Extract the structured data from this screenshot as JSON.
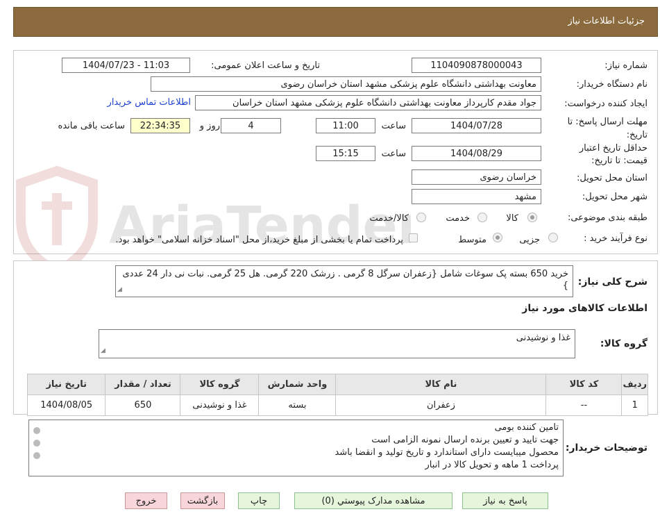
{
  "header": {
    "title": "جزئیات اطلاعات نیاز"
  },
  "form": {
    "need_number_label": "شماره نیاز:",
    "need_number": "1104090878000043",
    "announce_label": "تاریخ و ساعت اعلان عمومی:",
    "announce_value": "1404/07/23 - 11:03",
    "buyer_label": "نام دستگاه خریدار:",
    "buyer_value": "معاونت بهداشتی دانشگاه علوم پزشکی مشهد استان خراسان رضوی",
    "creator_label": "ایجاد کننده درخواست:",
    "creator_value": "جواد مقدم کارپرداز معاونت بهداشتی دانشگاه علوم پزشکی مشهد استان خراسان",
    "contact_link": "اطلاعات تماس خریدار",
    "deadline_label": "مهلت ارسال پاسخ: تا تاریخ:",
    "deadline_date": "1404/07/28",
    "time_label": "ساعت",
    "deadline_time": "11:00",
    "days_value": "4",
    "days_label": "روز و",
    "remaining_time": "22:34:35",
    "remaining_label": "ساعت باقی مانده",
    "validity_label": "حداقل تاریخ اعتبار قیمت: تا تاریخ:",
    "validity_date": "1404/08/29",
    "validity_time": "15:15",
    "province_label": "استان محل تحویل:",
    "province_value": "خراسان رضوی",
    "city_label": "شهر محل تحویل:",
    "city_value": "مشهد",
    "category_label": "طبقه بندی موضوعی:",
    "category_options": [
      "کالا",
      "خدمت",
      "کالا/خدمت"
    ],
    "category_selected": "کالا",
    "process_label": "نوع فرآیند خرید :",
    "process_options": [
      "جزیی",
      "متوسط"
    ],
    "process_selected": "متوسط",
    "payment_note": "پرداخت تمام یا بخشی از مبلغ خرید،از محل \"اسناد خزانه اسلامی\" خواهد بود."
  },
  "summary": {
    "label": "شرح کلی نیاز:",
    "text": "خرید 650 بسته پک سوغات شامل {زعفران سرگل 8 گرمی . زرشک 220 گرمی. هل 25 گرمی. نبات نی دار 24 عددی }"
  },
  "goods": {
    "section_title": "اطلاعات کالاهای مورد نیاز",
    "group_label": "گروه کالا:",
    "group_value": "غذا و نوشیدنی",
    "columns": [
      "ردیف",
      "کد کالا",
      "نام کالا",
      "واحد شمارش",
      "گروه کالا",
      "تعداد / مقدار",
      "تاریخ نیاز"
    ],
    "rows": [
      [
        "1",
        "--",
        "زعفران",
        "بسته",
        "غذا و نوشیدنی",
        "650",
        "1404/08/05"
      ]
    ]
  },
  "buyer_notes": {
    "label": "توضیحات خریدار:",
    "lines": [
      "تامین کننده بومی",
      "جهت تایید و تعیین برنده ارسال نمونه الزامی است",
      "محصول میبایست دارای استاندارد و تاریخ تولید و انقضا باشد",
      "پرداخت 1 ماهه و تحویل کالا در انبار"
    ]
  },
  "buttons": {
    "reply": "پاسخ به نیاز",
    "attachments": "مشاهده مدارک پیوستي (0)",
    "print": "چاپ",
    "back": "بازگشت",
    "exit": "خروج"
  },
  "watermark": {
    "text": "AriaTender.net"
  },
  "colors": {
    "header": "#8b6a3e",
    "button_green": "#e6f6dc",
    "button_red": "#f8d6dc",
    "link": "#1a3fd0",
    "time_highlight": "#ffffcc"
  }
}
